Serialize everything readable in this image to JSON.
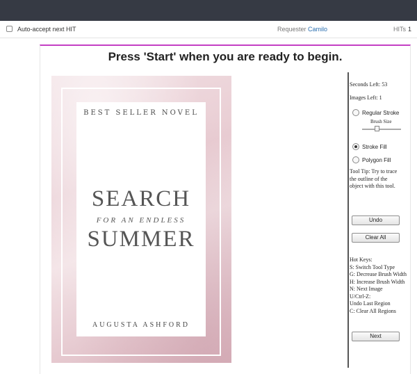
{
  "hitbar": {
    "auto_accept_label": "Auto-accept next HIT",
    "requester_label": "Requester",
    "requester_name": "Camilo",
    "hits_label": "HITs",
    "hits_count": "1"
  },
  "task": {
    "prompt": "Press 'Start' when you are ready to begin."
  },
  "cover": {
    "tagline": "BEST SELLER NOVEL",
    "title_line1": "SEARCH",
    "title_line2": "FOR AN ENDLESS",
    "title_line3": "SUMMER",
    "author": "AUGUSTA ASHFORD"
  },
  "sidebar": {
    "seconds_left": "Seconds Left: 53",
    "images_left": "Images Left: 1",
    "tools": [
      {
        "label": "Regular Stroke",
        "selected": false
      },
      {
        "label": "Stroke Fill",
        "selected": true
      },
      {
        "label": "Polygon Fill",
        "selected": false
      }
    ],
    "brush_size_label": "Brush Size",
    "tool_tip": [
      "Tool Tip: Try to trace",
      "the outline of the",
      "object with this tool."
    ],
    "undo_label": "Undo",
    "clear_all_label": "Clear All",
    "hot_keys": [
      "Hot Keys:",
      "S: Switch Tool Type",
      "G: Decrease Brush Width",
      "H: Increase Brush Width",
      "N: Next Image",
      "U/Ctrl-Z:",
      "Undo Last Region",
      "C: Clear All Regions"
    ],
    "next_label": "Next"
  }
}
